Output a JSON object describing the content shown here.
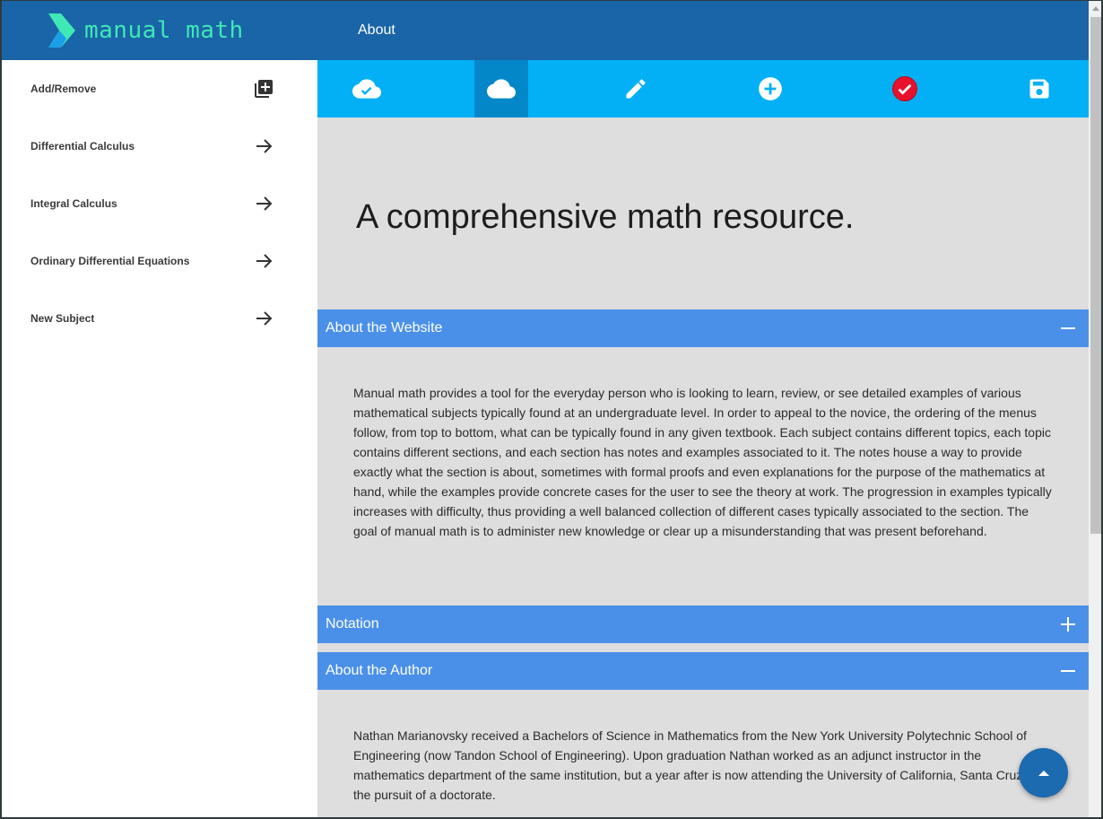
{
  "header": {
    "brand": "manual math",
    "nav_about": "About"
  },
  "sidebar": {
    "items": [
      {
        "label": "Add/Remove",
        "icon": "library-add-icon"
      },
      {
        "label": "Differential Calculus",
        "icon": "arrow-right-icon"
      },
      {
        "label": "Integral Calculus",
        "icon": "arrow-right-icon"
      },
      {
        "label": "Ordinary Differential Equations",
        "icon": "arrow-right-icon"
      },
      {
        "label": "New Subject",
        "icon": "arrow-right-icon"
      }
    ]
  },
  "toolbar": {
    "tools": [
      "cloud-done-icon",
      "cloud-icon",
      "pencil-icon",
      "add-circle-icon",
      "check-circle-icon",
      "save-icon"
    ],
    "active_tool": "cloud-icon"
  },
  "main": {
    "hero_title": "A comprehensive math resource.",
    "sections": [
      {
        "title": "About the Website",
        "expanded": true,
        "body": "Manual math provides a tool for the everyday person who is looking to learn, review, or see detailed examples of various mathematical subjects typically found at an undergraduate level. In order to appeal to the novice, the ordering of the menus follow, from top to bottom, what can be typically found in any given textbook. Each subject contains different topics, each topic contains different sections, and each section has notes and examples associated to it. The notes house a way to provide exactly what the section is about, sometimes with formal proofs and even explanations for the purpose of the mathematics at hand, while the examples provide concrete cases for the user to see the theory at work. The progression in examples typically increases with difficulty, thus providing a well balanced collection of different cases typically associated to the section. The goal of manual math is to administer new knowledge or clear up a misunderstanding that was present beforehand."
      },
      {
        "title": "Notation",
        "expanded": false
      },
      {
        "title": "About the Author",
        "expanded": true,
        "body": "Nathan Marianovsky received a Bachelors of Science in Mathematics from the New York University Polytechnic School of Engineering (now Tandon School of Engineering). Upon graduation Nathan worked as an adjunct instructor in the mathematics department of the same institution, but a year after is now attending the University of California, Santa Cruz in the pursuit of a doctorate."
      }
    ]
  },
  "colors": {
    "header_bg": "#1a64a8",
    "brand_text": "#3fe8b4",
    "toolbar_bg": "#03b0f5",
    "toolbar_active": "#0387c9",
    "accordion_bg": "#4a90e8",
    "content_bg": "#dedede",
    "check_circle": "#e8112d"
  },
  "fab": {
    "icon": "arrow-up-icon"
  }
}
